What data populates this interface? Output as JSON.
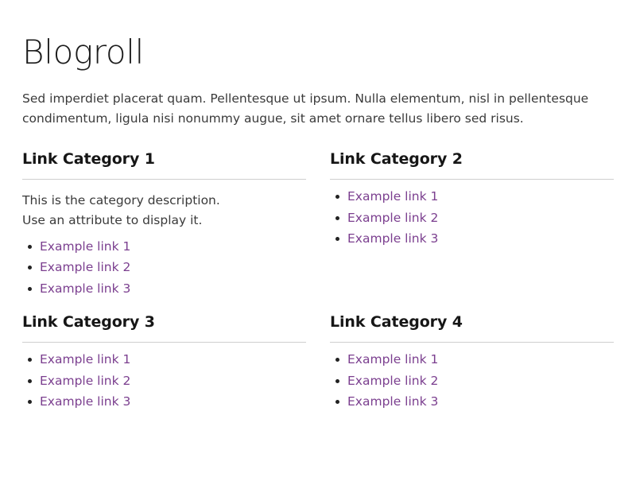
{
  "page": {
    "title": "Blogroll",
    "intro": "Sed imperdiet placerat quam. Pellentesque ut ipsum. Nulla elementum, nisl in pellentesque condimentum, ligula nisi nonummy augue, sit amet ornare tellus libero sed risus."
  },
  "colors": {
    "link": "#7b3f8f",
    "heading": "#161616",
    "body_text": "#3a3a3a",
    "rule": "#cfcfcf",
    "background": "#ffffff",
    "bullet": "#222222"
  },
  "categories": [
    {
      "title": "Link Category 1",
      "description": "This is the category description.\nUse an attribute to display it.",
      "links": [
        "Example link 1",
        "Example link 2",
        "Example link 3"
      ]
    },
    {
      "title": "Link Category 2",
      "description": "",
      "links": [
        "Example link 1",
        "Example link 2",
        "Example link 3"
      ]
    },
    {
      "title": "Link Category 3",
      "description": "",
      "links": [
        "Example link 1",
        "Example link 2",
        "Example link 3"
      ]
    },
    {
      "title": "Link Category 4",
      "description": "",
      "links": [
        "Example link 1",
        "Example link 2",
        "Example link 3"
      ]
    }
  ]
}
